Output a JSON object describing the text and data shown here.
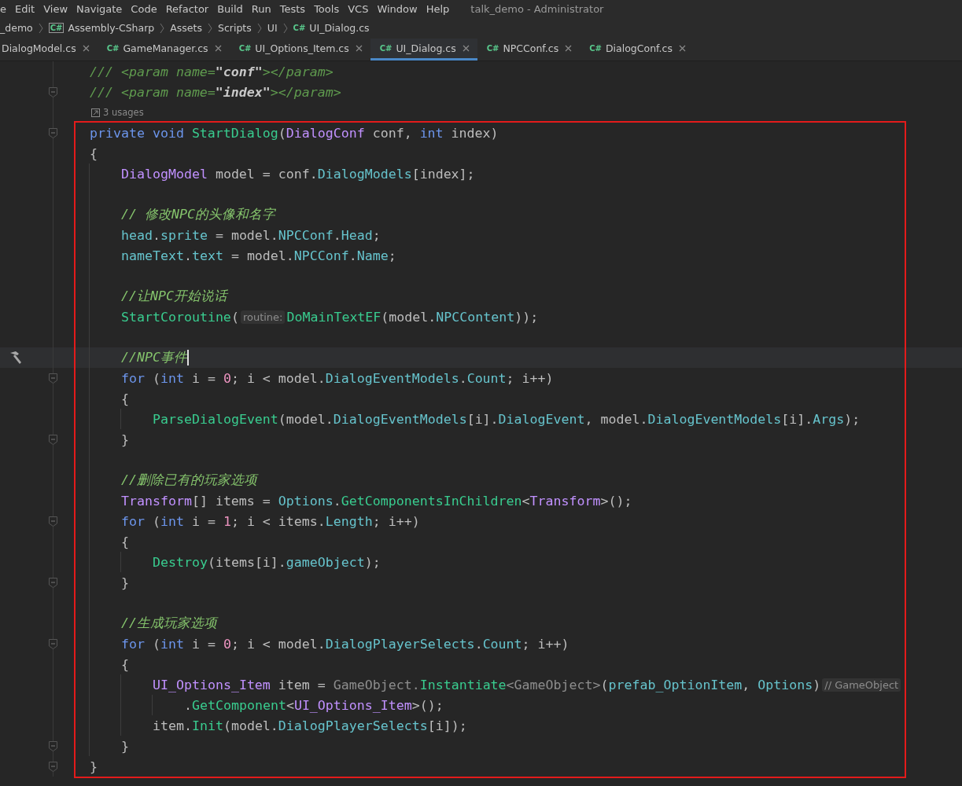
{
  "menu": [
    "e",
    "Edit",
    "View",
    "Navigate",
    "Code",
    "Refactor",
    "Build",
    "Run",
    "Tests",
    "Tools",
    "VCS",
    "Window",
    "Help"
  ],
  "window": {
    "title": "talk_demo - Administrator"
  },
  "breadcrumb": [
    {
      "label": "_demo"
    },
    {
      "label": "Assembly-CSharp",
      "icon": "C#"
    },
    {
      "label": "Assets"
    },
    {
      "label": "Scripts"
    },
    {
      "label": "UI"
    },
    {
      "label": "UI_Dialog.cs",
      "icon": "C#"
    }
  ],
  "tabs": [
    {
      "label": "DialogModel.cs",
      "selected": false
    },
    {
      "label": "GameManager.cs",
      "icon": "C#",
      "selected": false
    },
    {
      "label": "UI_Options_Item.cs",
      "icon": "C#",
      "selected": false
    },
    {
      "label": "UI_Dialog.cs",
      "icon": "C#",
      "selected": true
    },
    {
      "label": "NPCConf.cs",
      "icon": "C#",
      "selected": false
    },
    {
      "label": "DialogConf.cs",
      "icon": "C#",
      "selected": false
    }
  ],
  "lines": [
    {
      "kind": "code",
      "tokens": [
        {
          "text": "/// ",
          "kind": "doc"
        },
        {
          "text": "<param name=",
          "kind": "doc"
        },
        {
          "text": "\"conf\"",
          "kind": "docvalue"
        },
        {
          "text": "></param>",
          "kind": "doc"
        }
      ]
    },
    {
      "kind": "code",
      "fold": true,
      "tokens": [
        {
          "text": "/// ",
          "kind": "doc"
        },
        {
          "text": "<param name=",
          "kind": "doc"
        },
        {
          "text": "\"index\"",
          "kind": "docvalue"
        },
        {
          "text": "></param>",
          "kind": "doc"
        }
      ]
    },
    {
      "kind": "usages",
      "text": "3 usages"
    },
    {
      "kind": "code",
      "fold": true,
      "tokens": [
        {
          "text": "private void ",
          "kind": "keyword"
        },
        {
          "text": "StartDialog",
          "kind": "method"
        },
        {
          "text": "(",
          "kind": "plain"
        },
        {
          "text": "DialogConf",
          "kind": "type"
        },
        {
          "text": " conf, ",
          "kind": "plain"
        },
        {
          "text": "int",
          "kind": "keyword"
        },
        {
          "text": " index)",
          "kind": "plain"
        }
      ]
    },
    {
      "kind": "code",
      "tokens": [
        {
          "text": "{",
          "kind": "plain"
        }
      ],
      "children": [
        {
          "kind": "code",
          "tokens": [
            {
              "text": "DialogModel",
              "kind": "type"
            },
            {
              "text": " model = conf.",
              "kind": "plain"
            },
            {
              "text": "DialogModels",
              "kind": "member"
            },
            {
              "text": "[index];",
              "kind": "plain"
            }
          ]
        },
        {
          "kind": "blank"
        },
        {
          "kind": "code",
          "tokens": [
            {
              "text": "// 修改NPC的头像和名字",
              "kind": "comment"
            }
          ]
        },
        {
          "kind": "code",
          "tokens": [
            {
              "text": "head",
              "kind": "member"
            },
            {
              "text": ".",
              "kind": "plain"
            },
            {
              "text": "sprite",
              "kind": "member"
            },
            {
              "text": " = model.",
              "kind": "plain"
            },
            {
              "text": "NPCConf",
              "kind": "member"
            },
            {
              "text": ".",
              "kind": "plain"
            },
            {
              "text": "Head",
              "kind": "member"
            },
            {
              "text": ";",
              "kind": "plain"
            }
          ]
        },
        {
          "kind": "code",
          "tokens": [
            {
              "text": "nameText",
              "kind": "member"
            },
            {
              "text": ".",
              "kind": "plain"
            },
            {
              "text": "text",
              "kind": "member"
            },
            {
              "text": " = model.",
              "kind": "plain"
            },
            {
              "text": "NPCConf",
              "kind": "member"
            },
            {
              "text": ".",
              "kind": "plain"
            },
            {
              "text": "Name",
              "kind": "member"
            },
            {
              "text": ";",
              "kind": "plain"
            }
          ]
        },
        {
          "kind": "blank"
        },
        {
          "kind": "code",
          "tokens": [
            {
              "text": "//让NPC开始说话",
              "kind": "comment"
            }
          ]
        },
        {
          "kind": "code",
          "tokens": [
            {
              "text": "StartCoroutine",
              "kind": "method"
            },
            {
              "text": "(",
              "kind": "plain"
            },
            {
              "text": "routine:",
              "kind": "hint"
            },
            {
              "text": "DoMainTextEF",
              "kind": "method"
            },
            {
              "text": "(model.",
              "kind": "plain"
            },
            {
              "text": "NPCContent",
              "kind": "member"
            },
            {
              "text": "));",
              "kind": "plain"
            }
          ]
        },
        {
          "kind": "blank"
        },
        {
          "kind": "code",
          "current": true,
          "caret": true,
          "tool": true,
          "tokens": [
            {
              "text": "//NPC事件",
              "kind": "comment"
            }
          ]
        },
        {
          "kind": "code",
          "fold": true,
          "tokens": [
            {
              "text": "for",
              "kind": "keyword"
            },
            {
              "text": " (",
              "kind": "plain"
            },
            {
              "text": "int",
              "kind": "keyword"
            },
            {
              "text": " i = ",
              "kind": "plain"
            },
            {
              "text": "0",
              "kind": "number"
            },
            {
              "text": "; i < model.",
              "kind": "plain"
            },
            {
              "text": "DialogEventModels",
              "kind": "member"
            },
            {
              "text": ".",
              "kind": "plain"
            },
            {
              "text": "Count",
              "kind": "member"
            },
            {
              "text": "; i++)",
              "kind": "plain"
            }
          ]
        },
        {
          "kind": "code",
          "tokens": [
            {
              "text": "{",
              "kind": "plain"
            }
          ],
          "children": [
            {
              "kind": "code",
              "tokens": [
                {
                  "text": "ParseDialogEvent",
                  "kind": "method"
                },
                {
                  "text": "(model.",
                  "kind": "plain"
                },
                {
                  "text": "DialogEventModels",
                  "kind": "member"
                },
                {
                  "text": "[i].",
                  "kind": "plain"
                },
                {
                  "text": "DialogEvent",
                  "kind": "member"
                },
                {
                  "text": ", model.",
                  "kind": "plain"
                },
                {
                  "text": "DialogEventModels",
                  "kind": "member"
                },
                {
                  "text": "[i].",
                  "kind": "plain"
                },
                {
                  "text": "Args",
                  "kind": "member"
                },
                {
                  "text": ");",
                  "kind": "plain"
                }
              ]
            }
          ]
        },
        {
          "kind": "code",
          "fold": true,
          "tokens": [
            {
              "text": "}",
              "kind": "plain"
            }
          ]
        },
        {
          "kind": "blank"
        },
        {
          "kind": "code",
          "tokens": [
            {
              "text": "//删除已有的玩家选项",
              "kind": "comment"
            }
          ]
        },
        {
          "kind": "code",
          "tokens": [
            {
              "text": "Transform",
              "kind": "type"
            },
            {
              "text": "[] items = ",
              "kind": "plain"
            },
            {
              "text": "Options",
              "kind": "member"
            },
            {
              "text": ".",
              "kind": "plain"
            },
            {
              "text": "GetComponentsInChildren",
              "kind": "method"
            },
            {
              "text": "<",
              "kind": "plain"
            },
            {
              "text": "Transform",
              "kind": "type"
            },
            {
              "text": ">();",
              "kind": "plain"
            }
          ]
        },
        {
          "kind": "code",
          "fold": true,
          "tokens": [
            {
              "text": "for",
              "kind": "keyword"
            },
            {
              "text": " (",
              "kind": "plain"
            },
            {
              "text": "int",
              "kind": "keyword"
            },
            {
              "text": " i = ",
              "kind": "plain"
            },
            {
              "text": "1",
              "kind": "number"
            },
            {
              "text": "; i < items.",
              "kind": "plain"
            },
            {
              "text": "Length",
              "kind": "member"
            },
            {
              "text": "; i++)",
              "kind": "plain"
            }
          ]
        },
        {
          "kind": "code",
          "tokens": [
            {
              "text": "{",
              "kind": "plain"
            }
          ],
          "children": [
            {
              "kind": "code",
              "tokens": [
                {
                  "text": "Destroy",
                  "kind": "method"
                },
                {
                  "text": "(items[i].",
                  "kind": "plain"
                },
                {
                  "text": "gameObject",
                  "kind": "member"
                },
                {
                  "text": ");",
                  "kind": "plain"
                }
              ]
            }
          ]
        },
        {
          "kind": "code",
          "fold": true,
          "tokens": [
            {
              "text": "}",
              "kind": "plain"
            }
          ]
        },
        {
          "kind": "blank"
        },
        {
          "kind": "code",
          "tokens": [
            {
              "text": "//生成玩家选项",
              "kind": "comment"
            }
          ]
        },
        {
          "kind": "code",
          "fold": true,
          "tokens": [
            {
              "text": "for",
              "kind": "keyword"
            },
            {
              "text": " (",
              "kind": "plain"
            },
            {
              "text": "int",
              "kind": "keyword"
            },
            {
              "text": " i = ",
              "kind": "plain"
            },
            {
              "text": "0",
              "kind": "number"
            },
            {
              "text": "; i < model.",
              "kind": "plain"
            },
            {
              "text": "DialogPlayerSelects",
              "kind": "member"
            },
            {
              "text": ".",
              "kind": "plain"
            },
            {
              "text": "Count",
              "kind": "member"
            },
            {
              "text": "; i++)",
              "kind": "plain"
            }
          ]
        },
        {
          "kind": "code",
          "tokens": [
            {
              "text": "{",
              "kind": "plain"
            }
          ],
          "children": [
            {
              "kind": "code",
              "tokens": [
                {
                  "text": "UI_Options_Item",
                  "kind": "type"
                },
                {
                  "text": " item = ",
                  "kind": "plain"
                },
                {
                  "text": "GameObject.",
                  "kind": "inferred"
                },
                {
                  "text": "Instantiate",
                  "kind": "method"
                },
                {
                  "text": "<GameObject>",
                  "kind": "inferred"
                },
                {
                  "text": "(",
                  "kind": "plain"
                },
                {
                  "text": "prefab_OptionItem",
                  "kind": "member"
                },
                {
                  "text": ", ",
                  "kind": "plain"
                },
                {
                  "text": "Options",
                  "kind": "member"
                },
                {
                  "text": ")",
                  "kind": "plain"
                },
                {
                  "text": "// GameObject",
                  "kind": "hint"
                }
              ],
              "children": [
                {
                  "kind": "code",
                  "tokens": [
                    {
                      "text": ".",
                      "kind": "plain"
                    },
                    {
                      "text": "GetComponent",
                      "kind": "method"
                    },
                    {
                      "text": "<",
                      "kind": "plain"
                    },
                    {
                      "text": "UI_Options_Item",
                      "kind": "type"
                    },
                    {
                      "text": ">();",
                      "kind": "plain"
                    }
                  ]
                }
              ]
            },
            {
              "kind": "code",
              "tokens": [
                {
                  "text": "item.",
                  "kind": "plain"
                },
                {
                  "text": "Init",
                  "kind": "method"
                },
                {
                  "text": "(model.",
                  "kind": "plain"
                },
                {
                  "text": "DialogPlayerSelects",
                  "kind": "member"
                },
                {
                  "text": "[i]);",
                  "kind": "plain"
                }
              ]
            }
          ]
        },
        {
          "kind": "code",
          "fold": true,
          "tokens": [
            {
              "text": "}",
              "kind": "plain"
            }
          ]
        }
      ]
    },
    {
      "kind": "code",
      "fold": true,
      "tokens": [
        {
          "text": "}",
          "kind": "plain"
        }
      ]
    }
  ]
}
